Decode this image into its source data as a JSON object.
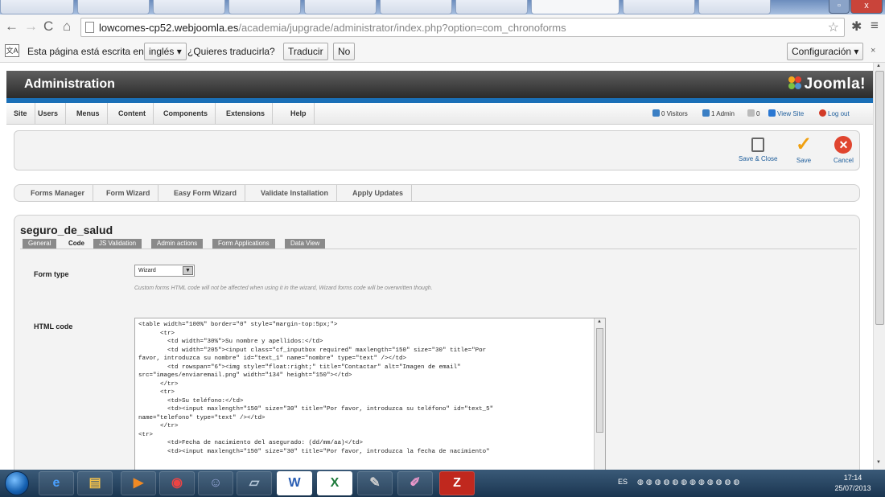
{
  "browser": {
    "url_host": "lowcomes-cp52.webjoomla.es",
    "url_path": "/academia/jupgrade/administrator/index.php?option=com_chronoforms"
  },
  "translate_bar": {
    "text": "Esta página está escrita en",
    "language": "inglés ▾",
    "question": "¿Quieres traducirla?",
    "translate_button": "Traducir",
    "no_button": "No",
    "settings_button": "Configuración ▾",
    "close": "×"
  },
  "joomla": {
    "title": "Administration",
    "logo": "Joomla!"
  },
  "menu": {
    "items": [
      "Site",
      "Users",
      "Menus",
      "Content",
      "Components",
      "Extensions",
      "Help"
    ],
    "visitors": "0 Visitors",
    "admins": "1 Admin",
    "messages": "0",
    "view_site": "View Site",
    "logout": "Log out"
  },
  "toolbar": {
    "save_close": "Save & Close",
    "save": "Save",
    "cancel": "Cancel"
  },
  "submenu": {
    "items": [
      "Forms Manager",
      "Form Wizard",
      "Easy Form Wizard",
      "Validate Installation",
      "Apply Updates"
    ]
  },
  "form": {
    "title": "seguro_de_salud",
    "tabs": [
      "General",
      "Code",
      "JS Validation",
      "Admin actions",
      "Form Applications",
      "Data View"
    ],
    "form_type_label": "Form type",
    "form_type_value": "Wizard",
    "hint": "Custom forms HTML code will not be affected when using it in the wizard, Wizard forms code will be overwritten though.",
    "html_code_label": "HTML code",
    "html_code": "<table width=\"100%\" border=\"0\" style=\"margin-top:5px;\">\n      <tr>\n        <td width=\"30%\">Su nombre y apellidos:</td>\n        <td width=\"205\"><input class=\"cf_inputbox required\" maxlength=\"150\" size=\"30\" title=\"Por\nfavor, introduzca su nombre\" id=\"text_1\" name=\"nombre\" type=\"text\" /></td>\n        <td rowspan=\"6\"><img style=\"float:right;\" title=\"Contactar\" alt=\"Imagen de email\"\nsrc=\"images/enviaremail.png\" width=\"134\" height=\"150\"></td>\n      </tr>\n      <tr>\n        <td>Su teléfono:</td>\n        <td><input maxlength=\"150\" size=\"30\" title=\"Por favor, introduzca su teléfono\" id=\"text_5\"\nname=\"telefono\" type=\"text\" /></td>\n      </tr>\n<tr>\n        <td>Fecha de nacimiento del asegurado: (dd/mm/aa)</td>\n        <td><input maxlength=\"150\" size=\"30\" title=\"Por favor, introduzca la fecha de nacimiento\""
  },
  "taskbar": {
    "lang": "ES",
    "time": "17:14",
    "date": "25/07/2013"
  }
}
